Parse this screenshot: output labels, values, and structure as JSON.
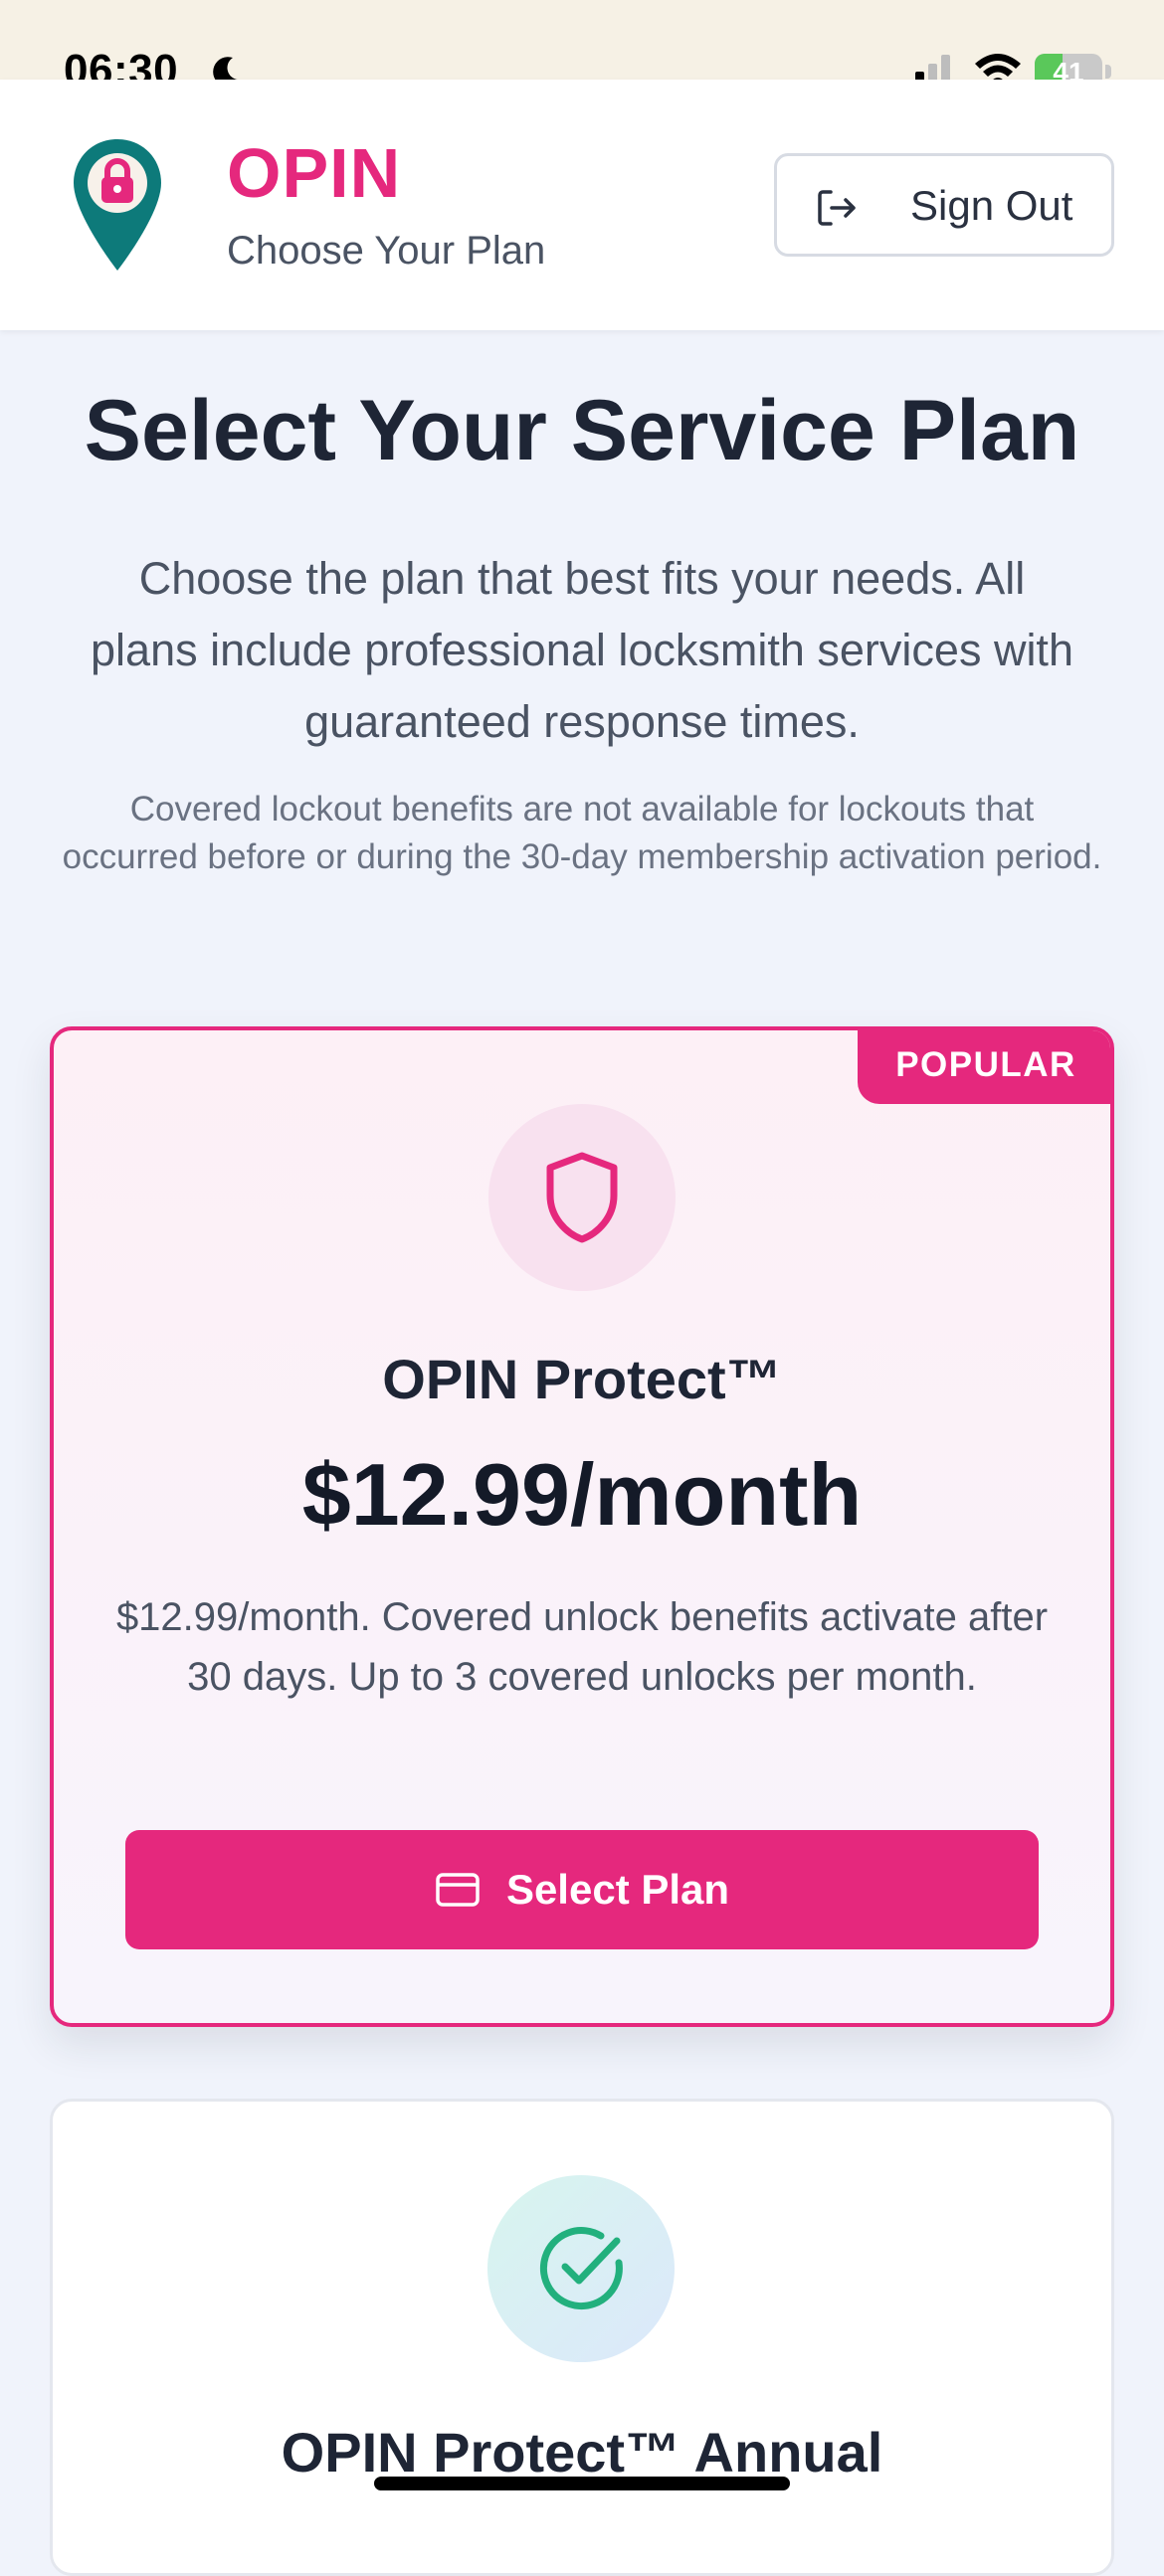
{
  "status_bar": {
    "time": "06:30",
    "battery": "41",
    "battery_level_percent": 41
  },
  "header": {
    "brand": "OPIN",
    "subtitle": "Choose Your Plan",
    "sign_out_label": "Sign Out"
  },
  "intro": {
    "title": "Select Your Service Plan",
    "description": "Choose the plan that best fits your needs. All plans include professional locksmith services with guaranteed response times.",
    "note": "Covered lockout benefits are not available for lockouts that occurred before or during the 30-day membership activation period."
  },
  "plans": [
    {
      "badge": "POPULAR",
      "icon": "shield-icon",
      "name": "OPIN Protect™",
      "price": "$12.99/month",
      "description": "$12.99/month. Covered unlock benefits activate after 30 days. Up to 3 covered unlocks per month.",
      "button_label": "Select Plan"
    },
    {
      "icon": "check-circle-icon",
      "name": "OPIN Protect™ Annual"
    }
  ],
  "colors": {
    "accent": "#e5287d",
    "teal": "#0d7a7a",
    "success": "#22b07d"
  }
}
